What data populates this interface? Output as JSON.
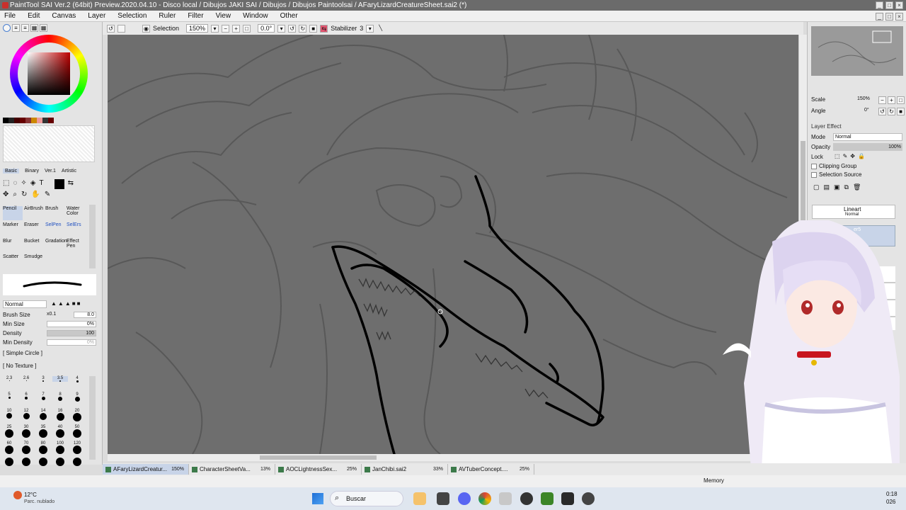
{
  "window": {
    "title": "PaintTool SAI Ver.2 (64bit) Preview.2020.04.10 - Disco local / Dibujos JAKI SAI / Dibujos / Dibujos Paintoolsai / AFaryLizardCreatureSheet.sai2 (*)"
  },
  "menu": [
    "File",
    "Edit",
    "Canvas",
    "Layer",
    "Selection",
    "Ruler",
    "Filter",
    "View",
    "Window",
    "Other"
  ],
  "toolbar": {
    "selection_label": "Selection",
    "zoom": "150%",
    "rotation": "0.0°",
    "stabilizer_label": "Stabilizer",
    "stabilizer_value": "3"
  },
  "left_panel": {
    "tool_tabs": [
      "Basic",
      "Binary",
      "Ver.1",
      "Artistic"
    ],
    "tools": [
      "Pencil",
      "AirBrush",
      "Brush",
      "Water Color",
      "Marker",
      "Eraser",
      "SelPen",
      "SelErs",
      "Blur",
      "Bucket",
      "Gradation",
      "Effect Pen",
      "Scatter",
      "Smudge"
    ],
    "blend_mode": "Normal",
    "brush_size_label": "Brush Size",
    "brush_size_mult": "x0.1",
    "brush_size_value": "8.0",
    "min_size_label": "Min Size",
    "min_size_value": "0%",
    "density_label": "Density",
    "density_value": "100",
    "min_density_label": "Min Density",
    "min_density_value": "0%",
    "shape_label": "[ Simple Circle ]",
    "texture_label": "[ No Texture ]",
    "dot_sizes": [
      "2.3",
      "2.6",
      "3",
      "3.5",
      "4",
      "5",
      "6",
      "7",
      "8",
      "9",
      "10",
      "12",
      "14",
      "16",
      "20",
      "25",
      "30",
      "35",
      "40",
      "50",
      "60",
      "70",
      "80",
      "100",
      "120",
      "",
      "",
      "",
      "",
      ""
    ]
  },
  "right_panel": {
    "scale_label": "Scale",
    "scale_value": "150%",
    "angle_label": "Angle",
    "angle_value": "0°",
    "layer_effect_label": "Layer Effect",
    "mode_label": "Mode",
    "mode_value": "Normal",
    "opacity_label": "Opacity",
    "opacity_value": "100%",
    "lock_label": "Lock",
    "clipping_label": "Clipping Group",
    "selection_source_label": "Selection Source",
    "layer_name": "Lineart",
    "layer_mode": "Normal",
    "layer2_partial": "er5"
  },
  "doc_tabs": [
    {
      "name": "AFaryLizardCreatur...",
      "pct": "150%",
      "active": true
    },
    {
      "name": "CharacterSheetVa...",
      "pct": "13%",
      "active": false
    },
    {
      "name": "AOCLightnessSex...",
      "pct": "25%",
      "active": false
    },
    {
      "name": "JanChibi.sai2",
      "pct": "33%",
      "active": false
    },
    {
      "name": "AVTuberConcept....",
      "pct": "25%",
      "active": false
    }
  ],
  "status": {
    "memory_label": "Memory"
  },
  "taskbar": {
    "weather_temp": "12°C",
    "weather_desc": "Parc. nublado",
    "search_placeholder": "Buscar",
    "clock_time": "0:18",
    "clock_date": "026"
  },
  "colors": {
    "canvas_bg": "#6e6e6e",
    "title_bg": "#6b6b6b",
    "selected_tab": "#c8d4e8",
    "ink": "#000000",
    "taskbar": "#dfe6ef"
  }
}
